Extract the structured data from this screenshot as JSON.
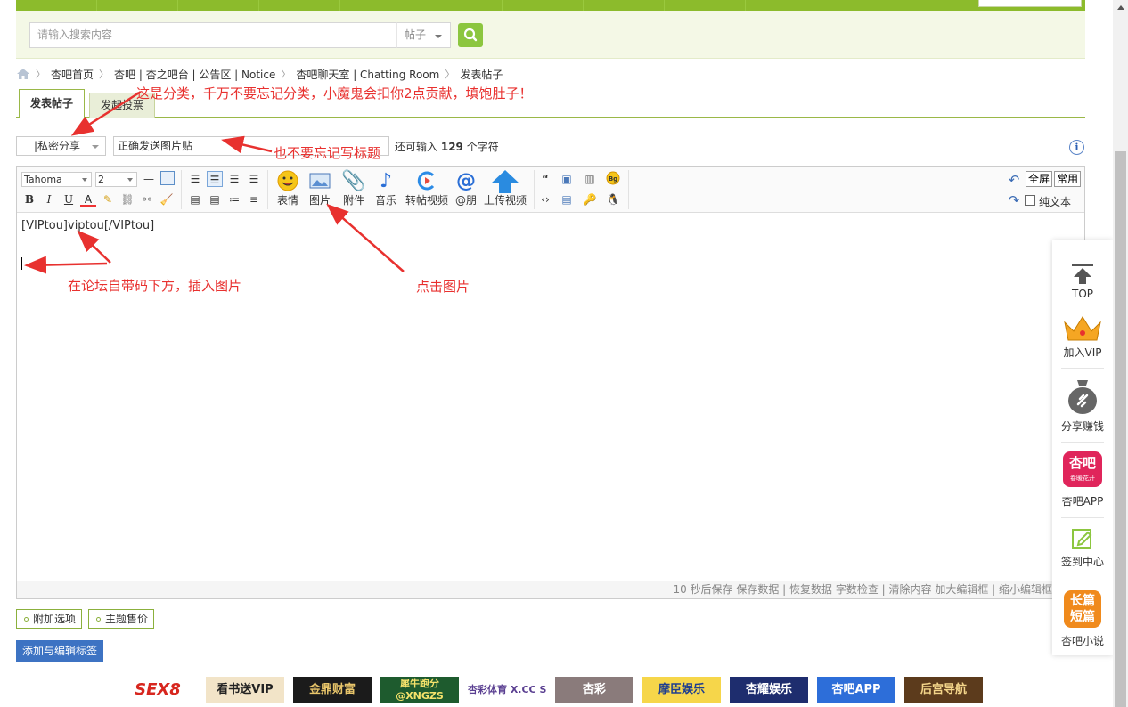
{
  "search": {
    "placeholder": "请输入搜索内容",
    "type_label": "帖子"
  },
  "breadcrumb": {
    "items": [
      "杏吧首页",
      "杏吧 | 杏之吧台 | 公告区 | Notice",
      "杏吧聊天室 | Chatting Room",
      "发表帖子"
    ]
  },
  "tabs": {
    "active": "发表帖子",
    "inactive": "发起投票"
  },
  "post": {
    "category": "|私密分享",
    "subject": "正确发送图片贴",
    "remain_prefix": "还可输入",
    "remain_count": "129",
    "remain_suffix": "个字符",
    "info_icon": "i"
  },
  "toolbar": {
    "font": "Tahoma",
    "size": "2",
    "buttons": {
      "emoji": "表情",
      "image": "图片",
      "attach": "附件",
      "music": "音乐",
      "video": "转帖视频",
      "at": "@朋",
      "upload_video": "上传视频"
    },
    "fullscreen": "全屏",
    "common": "常用",
    "plaintext": "纯文本"
  },
  "editor": {
    "content": "[VIPtou]viptou[/VIPtou]",
    "status": "10 秒后保存 保存数据 | 恢复数据    字数检查 | 清除内容    加大编辑框 | 缩小编辑框"
  },
  "options": {
    "extra": "附加选项",
    "sell": "主题售价",
    "tags": "添加与编辑标签"
  },
  "ads": [
    "SEX8",
    "看书送VIP",
    "金鼎财富",
    "犀牛跑分 @XNGZS",
    "杏彩体育 X.CC SPORTS",
    "杏彩",
    "摩臣娱乐",
    "杏耀娱乐",
    "杏吧APP",
    "后宫导航"
  ],
  "floatbar": {
    "top": "TOP",
    "vip": "加入VIP",
    "share": "分享赚钱",
    "app": "杏吧APP",
    "app_logo": "杏吧",
    "app_logo_sub": "春暖花开",
    "sign": "签到中心",
    "novel": "杏吧小说",
    "novel_logo_1": "长篇",
    "novel_logo_2": "短篇"
  },
  "annotations": {
    "category_note": "这是分类，千万不要忘记分类，小魔鬼会扣你2点贡献，填饱肚子！",
    "title_note": "也不要忘记写标题",
    "insert_note": "在论坛自带码下方，插入图片",
    "click_note": "点击图片"
  },
  "colors": {
    "accent_green": "#8cbb2c",
    "annotation_red": "#e8312f",
    "tag_button_blue": "#3d73c3"
  }
}
